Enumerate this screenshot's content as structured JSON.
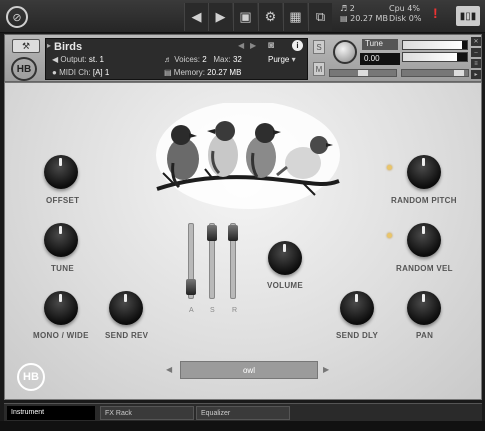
{
  "toolbar": {
    "logo_icon": "kontakt-logo-icon",
    "icons": [
      "back-arrow-icon",
      "forward-arrow-icon",
      "save-icon",
      "gear-icon",
      "layout-icon",
      "window-icon"
    ],
    "voices_count": "2",
    "memory": "20.27 MB",
    "cpu_label": "Cpu",
    "cpu_value": "4%",
    "disk_label": "Disk",
    "disk_value": "0%",
    "warning": "!",
    "keyboard_label": "▮▯▮"
  },
  "header": {
    "instrument_name": "Birds",
    "output_label": "Output:",
    "output_value": "st. 1",
    "midi_label": "MIDI Ch:",
    "midi_value": "[A] 1",
    "voices_label": "Voices:",
    "voices_value": "2",
    "max_label": "Max:",
    "max_value": "32",
    "purge_label": "Purge",
    "memory_label": "Memory:",
    "memory_value": "20.27 MB",
    "solo_label": "S",
    "mute_label": "M",
    "tune_label": "Tune",
    "tune_value": "0.00",
    "level_left": 0.92,
    "level_right": 0.85
  },
  "controls": {
    "offset": "OFFSET",
    "tune": "TUNE",
    "mono_wide": "MONO / WIDE",
    "send_rev": "SEND REV",
    "volume": "VOLUME",
    "send_dly": "SEND DLY",
    "pan": "PAN",
    "random_pitch": "RANDOM PITCH",
    "random_vel": "RANDOM VEL",
    "fader_a": "A",
    "fader_s": "S",
    "fader_r": "R",
    "preset": "owl",
    "prev_arrow": "◀",
    "next_arrow": "▶"
  },
  "tabs": {
    "instrument": "Instrument",
    "fx_rack": "FX Rack",
    "equalizer": "Equalizer"
  }
}
